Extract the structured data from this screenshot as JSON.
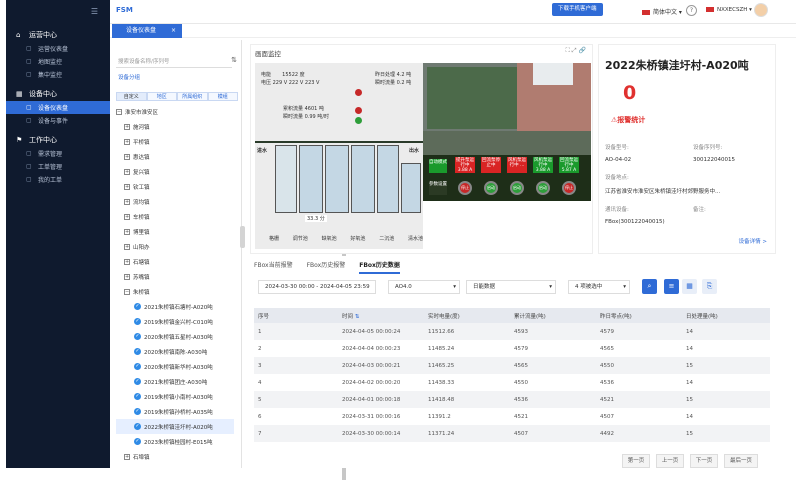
{
  "app": {
    "brand": "FSM",
    "download_app": "下载手机客户端",
    "language": "简体中文",
    "help": "?",
    "user": "NXXECSZH"
  },
  "tab": {
    "label": "设备仪表盘",
    "close": "×"
  },
  "sidebar": {
    "groups": [
      {
        "label": "运营中心",
        "icon": "home-icon",
        "items": [
          {
            "label": "运营仪表盘",
            "icon": "dashboard-icon"
          },
          {
            "label": "地图监控",
            "icon": "map-icon"
          },
          {
            "label": "集中监控",
            "icon": "monitor-icon"
          }
        ]
      },
      {
        "label": "设备中心",
        "icon": "grid-icon",
        "items": [
          {
            "label": "设备仪表盘",
            "icon": "dashboard-icon",
            "active": true
          },
          {
            "label": "设备与事件",
            "icon": "event-icon"
          }
        ]
      },
      {
        "label": "工作中心",
        "icon": "work-icon",
        "items": [
          {
            "label": "需求管理",
            "icon": "list-icon"
          },
          {
            "label": "工单管理",
            "icon": "ticket-icon"
          },
          {
            "label": "我的工单",
            "icon": "my-ticket-icon"
          }
        ]
      }
    ]
  },
  "tree_panel": {
    "search_placeholder": "搜索设备名称/序列号",
    "group_link": "设备分组",
    "filter_tabs": [
      "自定义",
      "地区",
      "所属组织",
      "模组"
    ],
    "root": "淮安市淮安区",
    "nodes": [
      "施河镇",
      "平桥镇",
      "惠达镇",
      "复兴镇",
      "钦工镇",
      "流均镇",
      "车桥镇",
      "博里镇",
      "山阳办",
      "石塘镇",
      "苏嘴镇",
      "朱桥镇"
    ],
    "devices": [
      "2021朱桥镇石塘村-A020吨",
      "2019朱桥镇金兴村-C010吨",
      "2020朱桥镇五星村-A030吨",
      "2020朱桥镇南陈-A030吨",
      "2020朱桥镇新华村-A030吨",
      "2021朱桥镇团庄-A030吨",
      "2019朱桥镇小南村-A030吨",
      "2019朱桥镇孙桥村-A035吨",
      "2022朱桥镇洼圩村-A020吨",
      "2023朱桥镇桂园村-E015吨"
    ],
    "selected_device": 8,
    "last_node": "石埠镇"
  },
  "monitor": {
    "title": "画面监控",
    "readouts": {
      "elec_label": "电能",
      "elec_value": "15522 度",
      "volt_label": "电压",
      "volt_value": "229 V 222 V 223 V",
      "today_flow_label": "昨日处理",
      "today_flow_value": "4.2 吨",
      "inst_flow_label": "瞬时流量",
      "inst_flow_value": "0.2 吨",
      "total_flow_label": "累积流量",
      "total_flow_value": "4601 吨",
      "cur_flow_label": "瞬时流量",
      "cur_flow_value": "0.99 吨/时",
      "level": "33.3 分"
    },
    "scada_labels": [
      "格栅",
      "调节池",
      "缺氧池",
      "好氧池",
      "二沉池",
      "清水池"
    ],
    "in_label": "进水",
    "out_label": "出水",
    "control": {
      "auto_label": "自动模式",
      "pump_labels": [
        "提升泵运行中 3.88 A",
        "回流泵停止中",
        "风机泵运行中 ...",
        "风机泵运行中 3.88 A",
        "回流泵运行中 5.87 A"
      ],
      "param_label": "参数设置",
      "lamp_labels": [
        "停止",
        "启动",
        "启动",
        "启动",
        "停止"
      ]
    }
  },
  "info": {
    "title": "2022朱桥镇洼圩村-A020吨",
    "alarm_count": "0",
    "alarm_label": "报警统计",
    "model_label": "设备型号:",
    "model_value": "AO-04-02",
    "serial_label": "设备序列号:",
    "serial_value": "300122040015",
    "location_label": "设备地点:",
    "location_value": "江苏省淮安市淮安区朱桥镇洼圩村郊野服务中...",
    "comm_label": "通讯设备:",
    "comm_value": "FBox(300122040015)",
    "remark_label": "备注:",
    "more": "设备详情 >"
  },
  "data_panel": {
    "tabs": [
      "FBox当前报警",
      "FBox历史报警",
      "FBox历史数据"
    ],
    "active_tab": 2,
    "date_range": "2024-03-30 00:00 - 2024-04-05 23:59",
    "device_select": "AO4.0",
    "type_select": "日能数据",
    "item_select": "4 项被选中",
    "columns": [
      "序号",
      "时间",
      "实时电量(度)",
      "累计流量(吨)",
      "昨日零点(吨)",
      "日处理量(吨)"
    ],
    "rows": [
      [
        "1",
        "2024-04-05 00:00:24",
        "11512.66",
        "4593",
        "4579",
        "14"
      ],
      [
        "2",
        "2024-04-04 00:00:23",
        "11485.24",
        "4579",
        "4565",
        "14"
      ],
      [
        "3",
        "2024-04-03 00:00:21",
        "11465.25",
        "4565",
        "4550",
        "15"
      ],
      [
        "4",
        "2024-04-02 00:00:20",
        "11438.33",
        "4550",
        "4536",
        "14"
      ],
      [
        "5",
        "2024-04-01 00:00:18",
        "11418.48",
        "4536",
        "4521",
        "15"
      ],
      [
        "6",
        "2024-03-31 00:00:16",
        "11391.2",
        "4521",
        "4507",
        "14"
      ],
      [
        "7",
        "2024-03-30 00:00:14",
        "11371.24",
        "4507",
        "4492",
        "15"
      ]
    ],
    "pager": [
      "第一页",
      "上一页",
      "下一页",
      "最后一页"
    ]
  }
}
